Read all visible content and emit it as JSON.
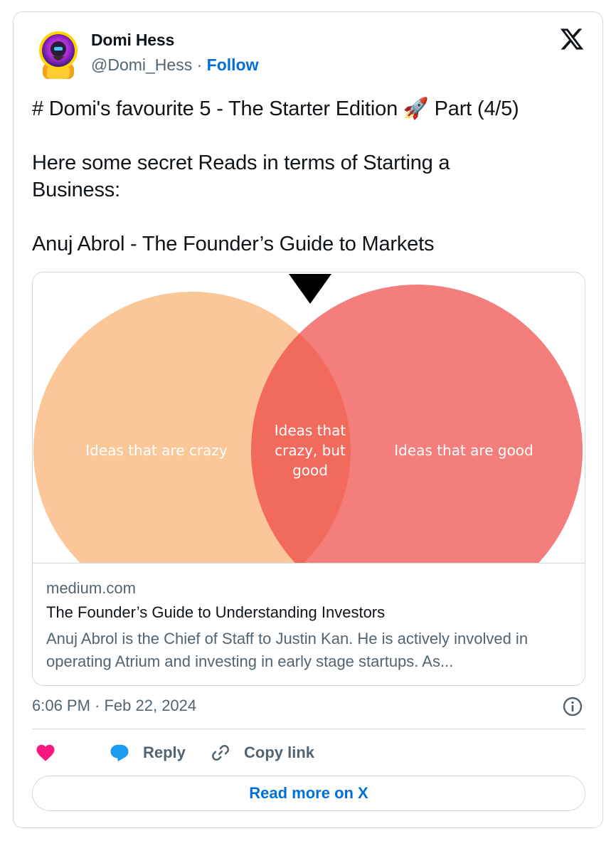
{
  "author": {
    "name": "Domi Hess",
    "handle": "@Domi_Hess",
    "separator": "·",
    "follow_label": "Follow"
  },
  "tweet": {
    "line1": "# Domi's favourite 5 - The Starter Edition 🚀 Part (4/5)",
    "line2": "Here some secret Reads in terms of Starting a Business:",
    "line3": "Anuj Abrol - The Founder’s Guide to Markets"
  },
  "link_card": {
    "image": {
      "left_label": "Ideas that are crazy",
      "overlap_label_lines": [
        "Ideas that",
        "crazy, but",
        "good"
      ],
      "right_label": "Ideas that are good",
      "colors": {
        "left": "#fbc798",
        "right": "#f37e7b",
        "overlap": "#f26a5c",
        "arrow": "#000000"
      }
    },
    "domain": "medium.com",
    "title": "The Founder’s Guide to Understanding Investors",
    "description": "Anuj Abrol is the Chief of Staff to Justin Kan. He is actively involved in operating Atrium and investing in early stage startups. As..."
  },
  "timestamp": "6:06 PM · Feb 22, 2024",
  "actions": {
    "reply_label": "Reply",
    "copy_link_label": "Copy link"
  },
  "read_more_label": "Read more on X",
  "colors": {
    "link_blue": "#006fd6",
    "like_pink": "#f91880",
    "reply_blue": "#1d9bf0",
    "muted": "#536471"
  },
  "icons": [
    "x-logo-icon",
    "info-icon",
    "heart-icon",
    "reply-bubble-icon",
    "link-icon",
    "rocket-emoji"
  ]
}
